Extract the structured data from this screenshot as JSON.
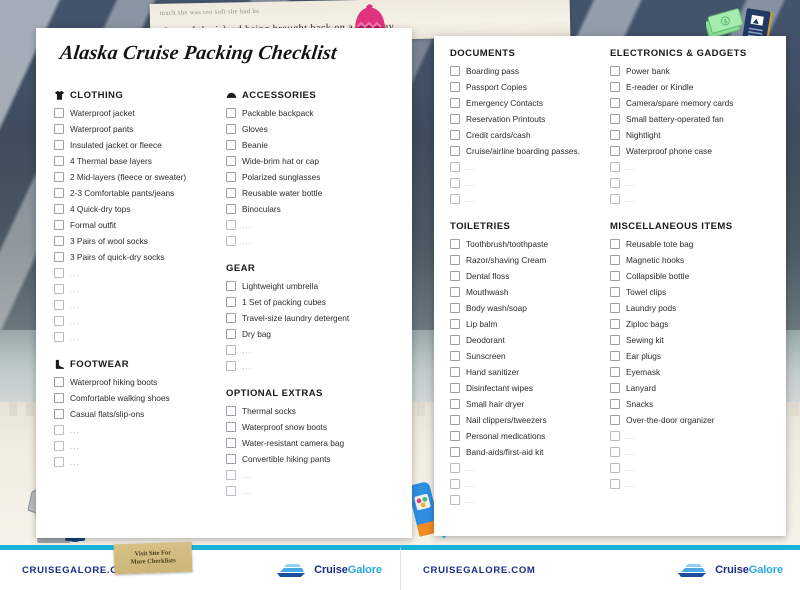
{
  "document": {
    "title": "Alaska Cruise Packing Checklist",
    "background_note_line1": "much she was too soft she had be",
    "background_note_line2": "signs of the island being brought back on a runaway,"
  },
  "sticky_note": {
    "line1": "Visit Site For",
    "line2": "More Checklists"
  },
  "colors": {
    "accent_cyan": "#18b4d8",
    "brand_navy": "#1c2d8a",
    "brand_blue": "#2aa8e0",
    "checkbox_border": "#9aa0a6",
    "text": "#2b2b2b"
  },
  "blank_placeholder": "...",
  "left_page": {
    "columns": [
      {
        "sections": [
          {
            "heading": "CLOTHING",
            "icon": "tshirt-icon",
            "items": [
              "Waterproof jacket",
              "Waterproof pants",
              "Insulated jacket or fleece",
              "4 Thermal base layers",
              "2 Mid-layers (fleece or sweater)",
              "2-3 Comfortable pants/jeans",
              "4 Quick-dry tops",
              "Formal outfit",
              "3 Pairs of wool socks",
              "3 Pairs of quick-dry socks"
            ],
            "blank_rows": 5
          },
          {
            "heading": "FOOTWEAR",
            "icon": "boot-icon",
            "items": [
              "Waterproof hiking boots",
              "Comfortable walking shoes",
              "Casual flats/slip-ons"
            ],
            "blank_rows": 3
          }
        ]
      },
      {
        "sections": [
          {
            "heading": "ACCESSORIES",
            "icon": "hat-icon",
            "items": [
              "Packable backpack",
              "Gloves",
              "Beanie",
              "Wide-brim hat or cap",
              "Polarized sunglasses",
              "Reusable water bottle",
              "Binoculars"
            ],
            "blank_rows": 2
          },
          {
            "heading": "GEAR",
            "icon": "",
            "items": [
              "Lightweight umbrella",
              "1 Set of packing cubes",
              "Travel-size laundry detergent",
              "Dry bag"
            ],
            "blank_rows": 2
          },
          {
            "heading": "OPTIONAL EXTRAS",
            "icon": "",
            "items": [
              "Thermal socks",
              "Waterproof snow boots",
              "Water-resistant camera bag",
              "Convertible hiking pants"
            ],
            "blank_rows": 2
          }
        ]
      }
    ]
  },
  "right_page": {
    "columns": [
      {
        "sections": [
          {
            "heading": "DOCUMENTS",
            "icon": "",
            "items": [
              "Boarding pass",
              "Passport Copies",
              "Emergency Contacts",
              "Reservation Printouts",
              "Credit cards/cash",
              "Cruise/airline boarding passes."
            ],
            "blank_rows": 3
          },
          {
            "heading": "TOILETRIES",
            "icon": "",
            "items": [
              "Toothbrush/toothpaste",
              "Razor/shaving Cream",
              "Dental floss",
              "Mouthwash",
              "Body wash/soap",
              "Lip balm",
              "Deodorant",
              "Sunscreen",
              "Hand sanitizer",
              "Disinfectant wipes",
              "Small hair dryer",
              "Nail clippers/tweezers",
              "Personal medications",
              "Band-aids/first-aid kit"
            ],
            "blank_rows": 3
          }
        ]
      },
      {
        "sections": [
          {
            "heading": "ELECTRONICS & GADGETS",
            "icon": "",
            "items": [
              "Power bank",
              "E-reader or Kindle",
              "Camera/spare memory cards",
              "Small battery-operated fan",
              "Nightlight",
              "Waterproof phone case"
            ],
            "blank_rows": 3
          },
          {
            "heading": "MISCELLANEOUS ITEMS",
            "icon": "",
            "items": [
              "Reusable tote bag",
              "Magnetic hooks",
              "Collapsible bottle",
              "Towel clips",
              "Laundry pods",
              "Ziploc bags",
              "Sewing kit",
              "Ear plugs",
              "Eyemask",
              "Lanyard",
              "Snacks",
              "Over-the-door organizer"
            ],
            "blank_rows": 4
          }
        ]
      }
    ]
  },
  "footer": {
    "url": "CRUISEGALORE.COM",
    "brand_first": "Cruise",
    "brand_second": "Galore"
  }
}
